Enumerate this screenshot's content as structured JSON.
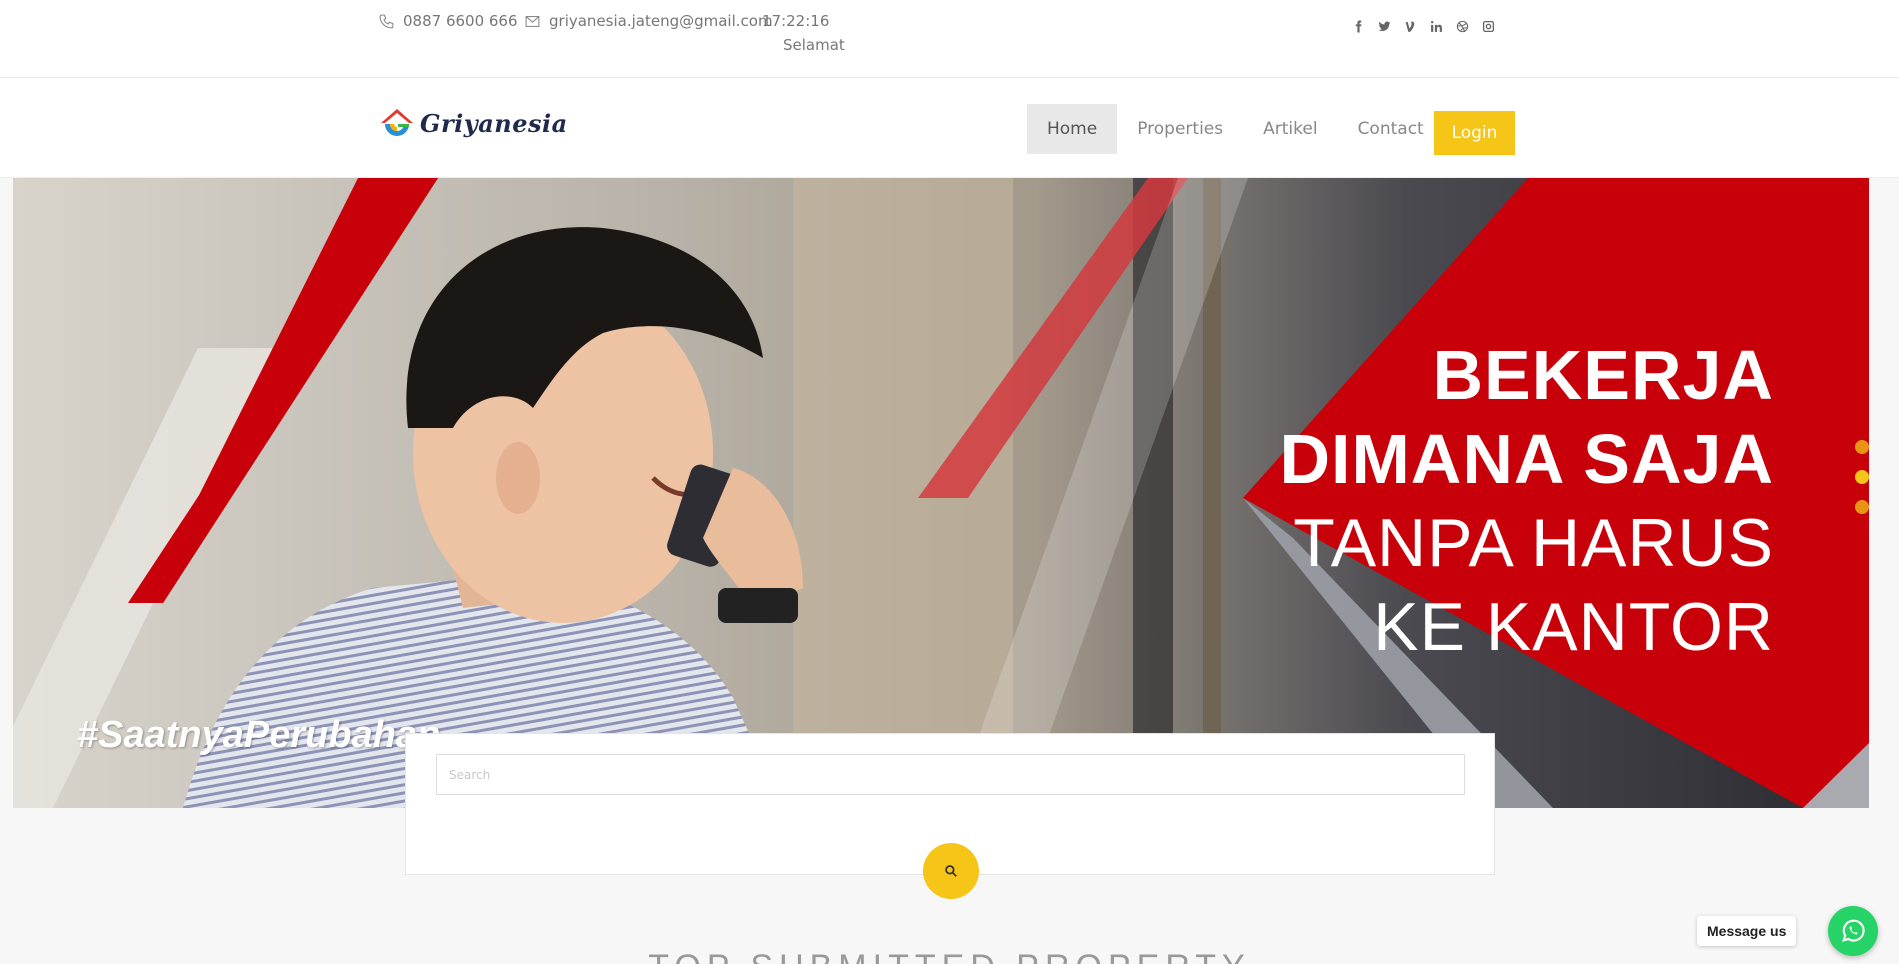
{
  "topbar": {
    "phone": "0887 6600 666",
    "email": "griyanesia.jateng@gmail.com",
    "time": "17:22:16",
    "greeting": "Selamat",
    "socials": [
      "facebook-icon",
      "twitter-icon",
      "vine-icon",
      "linkedin-icon",
      "dribbble-icon",
      "instagram-icon"
    ]
  },
  "header": {
    "logo_text": "Griyanesia",
    "nav": [
      {
        "label": "Home",
        "active": true
      },
      {
        "label": "Properties"
      },
      {
        "label": "Artikel"
      },
      {
        "label": "Contact"
      }
    ],
    "login_label": "Login"
  },
  "hero": {
    "line1": "BEKERJA",
    "line2": "DIMANA SAJA",
    "line3": "TANPA HARUS",
    "line4": "KE KANTOR",
    "hashtag": "#SaatnyaPerubahan",
    "slides": 3,
    "active_slide": 2
  },
  "search": {
    "placeholder": "Search"
  },
  "section": {
    "title": "TOP SUBMITTED PROPERTY"
  },
  "whatsapp": {
    "label": "Message us"
  },
  "colors": {
    "accent": "#f5c518",
    "hero_red": "#c8000a",
    "whatsapp": "#25d366"
  }
}
